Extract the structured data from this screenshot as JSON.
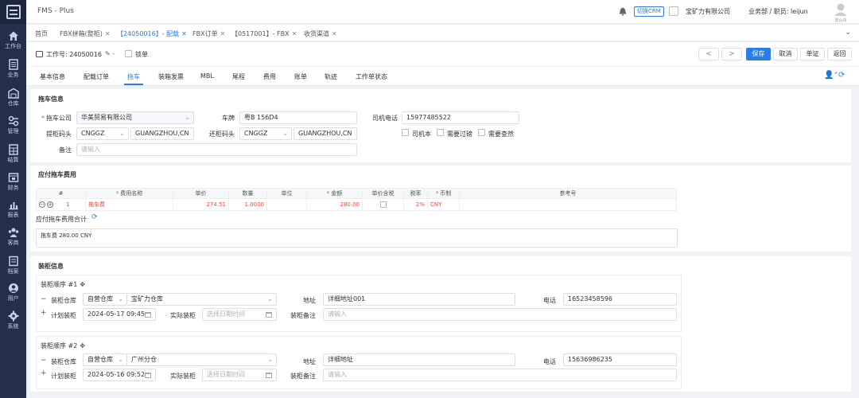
{
  "app": {
    "title": "FMS - Plus"
  },
  "header": {
    "crm_label": "切换CRM",
    "company": "宝矿力有限公司",
    "dept": "业务部 / 职员: leijun",
    "avatar_label": "雷山舟"
  },
  "sidebar": {
    "items": [
      {
        "label": "工作台",
        "icon": "home-icon"
      },
      {
        "label": "业务",
        "icon": "document-icon"
      },
      {
        "label": "仓库",
        "icon": "warehouse-icon"
      },
      {
        "label": "管理",
        "icon": "manage-icon"
      },
      {
        "label": "结算",
        "icon": "calculator-icon"
      },
      {
        "label": "财务",
        "icon": "finance-icon"
      },
      {
        "label": "报表",
        "icon": "chart-icon"
      },
      {
        "label": "客商",
        "icon": "clients-icon"
      },
      {
        "label": "档案",
        "icon": "archive-icon"
      },
      {
        "label": "用户",
        "icon": "user-icon"
      },
      {
        "label": "系统",
        "icon": "gear-icon"
      }
    ]
  },
  "page_tabs": [
    {
      "label": "首页",
      "closable": false
    },
    {
      "label": "FBX拼箱(整柜)",
      "closable": true
    },
    {
      "label": "【24050016】- 配载",
      "closable": true,
      "active": true
    },
    {
      "label": "FBX订单",
      "closable": true
    },
    {
      "label": "【0517001】- FBX",
      "closable": true
    },
    {
      "label": "收货渠道",
      "closable": true
    }
  ],
  "toolbar": {
    "job_label": "工作号: 24050016",
    "dash": "-",
    "lock_label": "锁单",
    "prev": "<",
    "next": ">",
    "save": "保存",
    "cancel": "取消",
    "voucher": "单证",
    "back": "返回"
  },
  "section_tabs": [
    "基本信息",
    "配载订单",
    "拖车",
    "装箱发票",
    "MBL",
    "尾程",
    "费用",
    "账单",
    "轨迹",
    "工作单状态"
  ],
  "active_section_tab": "拖车",
  "truck_info": {
    "title": "拖车信息",
    "company_label": "拖车公司",
    "company_value": "华美贸易有限公司",
    "plate_label": "车牌",
    "plate_value": "粤B 156D4",
    "phone_label": "司机电话",
    "phone_value": "15977485522",
    "pickup_label": "提柜码头",
    "pickup_code": "CNGGZ",
    "pickup_name": "GUANGZHOU,CN",
    "return_label": "还柜码头",
    "return_code": "CNGGZ",
    "return_name": "GUANGZHOU,CN",
    "driver_book": "司机本",
    "need_weigh": "需要过磅",
    "need_seal": "需要查然",
    "remark_label": "备注",
    "remark_placeholder": "请输入"
  },
  "fees": {
    "title": "应付拖车费用",
    "columns": [
      "#",
      "费用名称",
      "单价",
      "数量",
      "单位",
      "金额",
      "单价含税",
      "税率",
      "币制",
      "参考号"
    ],
    "rows": [
      {
        "no": "1",
        "name": "拖车费",
        "price": "274.51",
        "qty": "1.0000",
        "unit": "",
        "amount": "280.00",
        "tax_incl": "",
        "tax_rate": "2%",
        "currency": "CNY",
        "ref": ""
      }
    ],
    "total_label": "应付拖车费用合计",
    "total_text": "拖车费 280.00 CNY"
  },
  "loading": {
    "title": "装柜信息",
    "sequences": [
      {
        "title": "装柜顺序 #1",
        "warehouse_label": "装柜仓库",
        "warehouse_type": "自营仓库",
        "warehouse_name": "宝矿力仓库",
        "address_label": "地址",
        "address_value": "详细地址001",
        "phone_label": "电话",
        "phone_value": "16523458596",
        "plan_label": "计划装柜",
        "plan_value": "2024-05-17 09:45",
        "actual_label": "实际装柜",
        "actual_placeholder": "选择日期时间",
        "remark_label": "装柜备注",
        "remark_placeholder": "请输入"
      },
      {
        "title": "装柜顺序 #2",
        "warehouse_label": "装柜仓库",
        "warehouse_type": "自营仓库",
        "warehouse_name": "广州分仓",
        "address_label": "地址",
        "address_value": "详细地址",
        "phone_label": "电话",
        "phone_value": "15636986235",
        "plan_label": "计划装柜",
        "plan_value": "2024-05-16 09:52",
        "actual_label": "实际装柜",
        "actual_placeholder": "选择日期时间",
        "remark_label": "装柜备注",
        "remark_placeholder": "请输入"
      }
    ]
  },
  "colors": {
    "primary": "#2b7de9",
    "sidebar": "#232f4b",
    "required": "#e54d42"
  }
}
